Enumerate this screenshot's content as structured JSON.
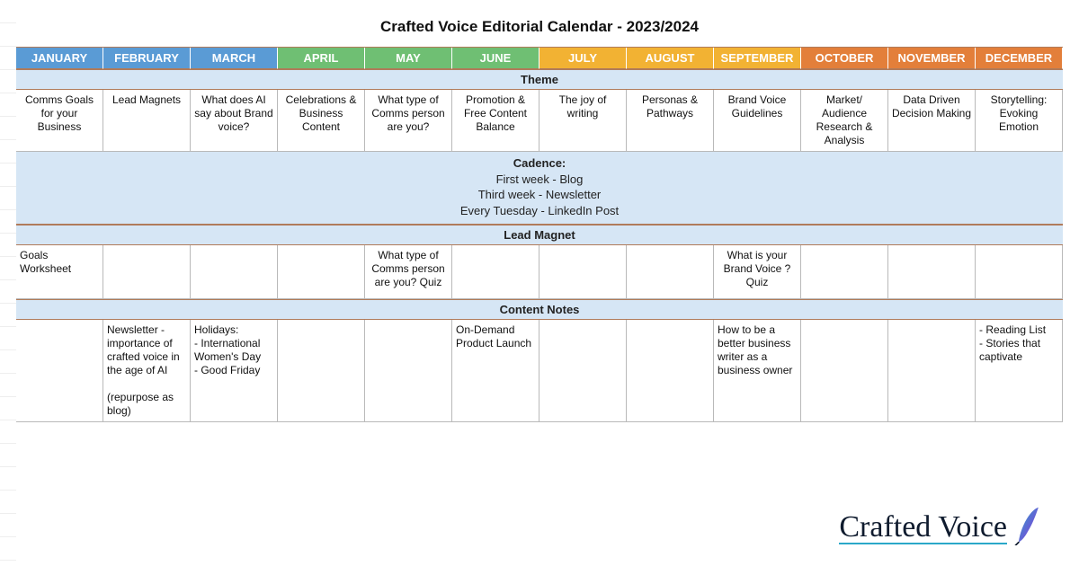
{
  "title": "Crafted Voice Editorial Calendar - 2023/2024",
  "months": [
    "JANUARY",
    "FEBRUARY",
    "MARCH",
    "APRIL",
    "MAY",
    "JUNE",
    "JULY",
    "AUGUST",
    "SEPTEMBER",
    "OCTOBER",
    "NOVEMBER",
    "DECEMBER"
  ],
  "section_labels": {
    "theme": "Theme",
    "lead_magnet": "Lead Magnet",
    "content_notes": "Content Notes"
  },
  "cadence": {
    "title": "Cadence:",
    "lines": [
      "First week -  Blog",
      "Third week - Newsletter",
      "Every Tuesday - LinkedIn Post"
    ]
  },
  "themes": [
    "Comms Goals for your Business",
    "Lead Magnets",
    "What does AI say about Brand voice?",
    "Celebrations & Business Content",
    "What type of Comms person are you?",
    "Promotion & Free Content Balance",
    "The joy of writing",
    "Personas & Pathways",
    "Brand Voice Guidelines",
    "Market/ Audience Research & Analysis",
    "Data Driven Decision Making",
    "Storytelling: Evoking Emotion"
  ],
  "lead_magnets": [
    "Goals Worksheet",
    "",
    "",
    "",
    "What type of Comms person are you? Quiz",
    "",
    "",
    "",
    "What is your Brand Voice ? Quiz",
    "",
    "",
    ""
  ],
  "content_notes": [
    "",
    "Newsletter - importance of crafted voice in the age of AI\n\n(repurpose as blog)",
    "Holidays:\n- International Women's Day\n- Good Friday",
    "",
    "",
    "On-Demand Product Launch",
    "",
    "",
    "How to be a better business writer as a business owner",
    "",
    "",
    "- Reading List\n- Stories that captivate"
  ],
  "logo_text": "Crafted Voice"
}
